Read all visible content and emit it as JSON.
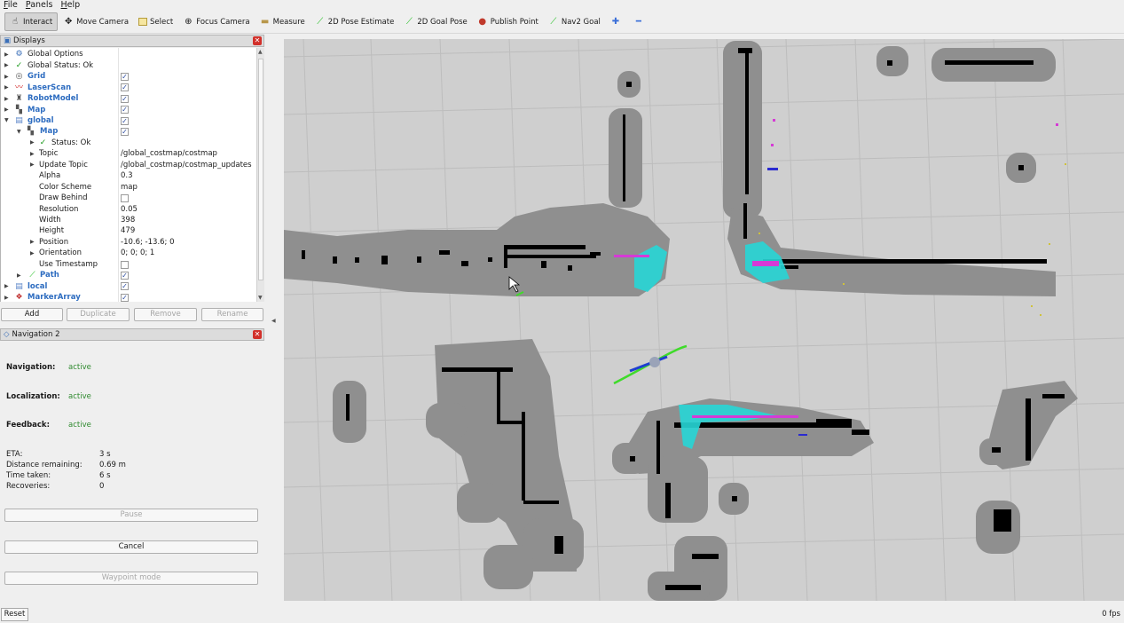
{
  "menu": [
    "File",
    "Panels",
    "Help"
  ],
  "toolbar": [
    {
      "label": "Interact",
      "icon": "cursor-icon"
    },
    {
      "label": "Move Camera",
      "icon": "move-camera-icon"
    },
    {
      "label": "Select",
      "icon": "select-icon"
    },
    {
      "label": "Focus Camera",
      "icon": "focus-camera-icon"
    },
    {
      "label": "Measure",
      "icon": "ruler-icon"
    },
    {
      "label": "2D Pose Estimate",
      "icon": "green-arrow-icon"
    },
    {
      "label": "2D Goal Pose",
      "icon": "green-arrow-icon"
    },
    {
      "label": "Publish Point",
      "icon": "map-pin-icon"
    },
    {
      "label": "Nav2 Goal",
      "icon": "green-arrow-icon"
    }
  ],
  "displays": {
    "title": "Displays",
    "rows": [
      {
        "label": "Global Options",
        "value": ""
      },
      {
        "label": "Global Status: Ok",
        "value": ""
      },
      {
        "label": "Grid",
        "checked": true
      },
      {
        "label": "LaserScan",
        "checked": true
      },
      {
        "label": "RobotModel",
        "checked": true
      },
      {
        "label": "Map",
        "checked": true
      },
      {
        "label": "global",
        "checked": true
      },
      {
        "label": "Map",
        "checked": true
      },
      {
        "label": "Status: Ok",
        "value": ""
      },
      {
        "label": "Topic",
        "value": "/global_costmap/costmap"
      },
      {
        "label": "Update Topic",
        "value": "/global_costmap/costmap_updates"
      },
      {
        "label": "Alpha",
        "value": "0.3"
      },
      {
        "label": "Color Scheme",
        "value": "map"
      },
      {
        "label": "Draw Behind",
        "checked": false
      },
      {
        "label": "Resolution",
        "value": "0.05"
      },
      {
        "label": "Width",
        "value": "398"
      },
      {
        "label": "Height",
        "value": "479"
      },
      {
        "label": "Position",
        "value": "-10.6; -13.6; 0"
      },
      {
        "label": "Orientation",
        "value": "0; 0; 0; 1"
      },
      {
        "label": "Use Timestamp",
        "checked": false
      },
      {
        "label": "Path",
        "checked": true
      },
      {
        "label": "local",
        "checked": true
      },
      {
        "label": "MarkerArray",
        "checked": true
      }
    ],
    "buttons": [
      "Add",
      "Duplicate",
      "Remove",
      "Rename"
    ]
  },
  "navigation": {
    "title": "Navigation 2",
    "status": [
      {
        "label": "Navigation:",
        "value": "active"
      },
      {
        "label": "Localization:",
        "value": "active"
      },
      {
        "label": "Feedback:",
        "value": "active"
      }
    ],
    "stats": [
      {
        "label": "ETA:",
        "value": "3 s"
      },
      {
        "label": "Distance remaining:",
        "value": "0.69 m"
      },
      {
        "label": "Time taken:",
        "value": "6 s"
      },
      {
        "label": "Recoveries:",
        "value": "0"
      }
    ],
    "pause_label": "Pause",
    "cancel_label": "Cancel",
    "waypoint_label": "Waypoint mode"
  },
  "statusbar": {
    "reset_label": "Reset",
    "fps": "0 fps"
  },
  "colors": {
    "grid_bg": "#cfcfcf",
    "costmap_gray": "#8c8c8c",
    "obstacle": "#000000",
    "inflation_cyan": "#27d6d6",
    "laser_magenta": "#d63ad6",
    "path_green": "#3fdb2a",
    "robot_blue": "#1f3fd0"
  }
}
